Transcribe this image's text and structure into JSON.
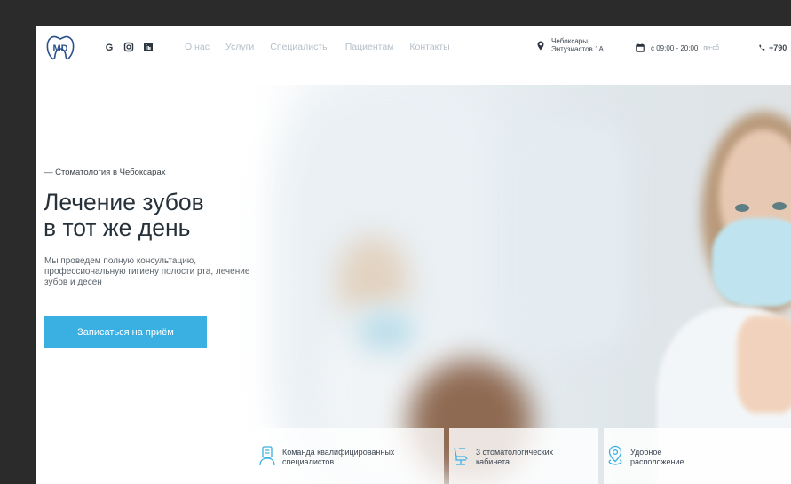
{
  "brand": {
    "logo_text": "MD",
    "accent": "#3ab0e2"
  },
  "social": [
    {
      "icon": "google-icon"
    },
    {
      "icon": "instagram-icon"
    },
    {
      "icon": "linkedin-icon"
    }
  ],
  "nav": [
    "О нас",
    "Услуги",
    "Специалисты",
    "Пациентам",
    "Контакты"
  ],
  "header": {
    "address_line1": "Чебоксары,",
    "address_line2": "Энтузиастов 1А",
    "hours": "с 09:00 - 20:00",
    "days": "пн-сб",
    "phone": "+790"
  },
  "hero": {
    "eyebrow": "— Стоматология в Чебоксарах",
    "title_line1": "Лечение зубов",
    "title_line2": "в тот же день",
    "description": "Мы проведем полную консультацию, профессиональную гигиену полости рта, лечение зубов и десен",
    "cta_label": "Записаться на приём"
  },
  "features": [
    {
      "icon": "badge-icon",
      "line1": "Команда квалифицированных",
      "line2": "специалистов"
    },
    {
      "icon": "dental-chair-icon",
      "line1": "3 стоматологических",
      "line2": "кабинета"
    },
    {
      "icon": "location-pin-icon",
      "line1": "Удобное",
      "line2": "расположение"
    }
  ]
}
